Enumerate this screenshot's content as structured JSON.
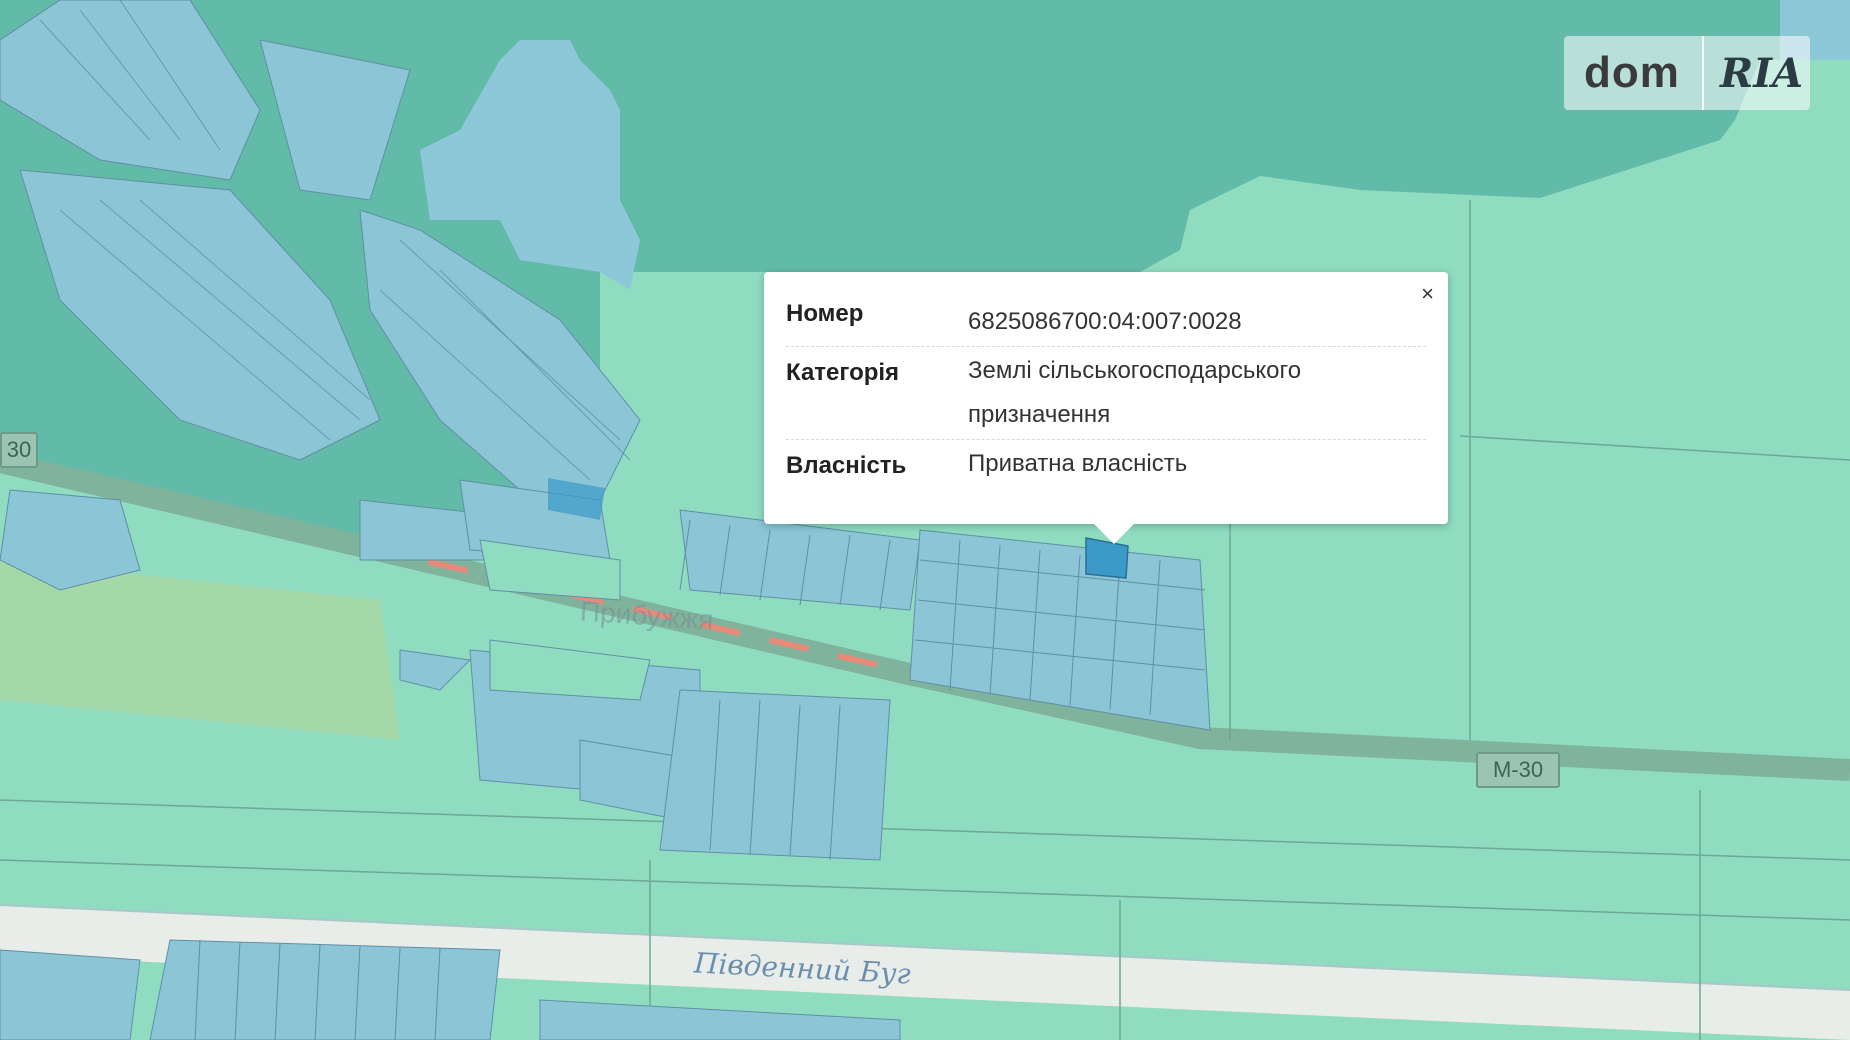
{
  "popup": {
    "close": "×",
    "rows": [
      {
        "key": "Номер",
        "value": "6825086700:04:007:0028"
      },
      {
        "key": "Категорія",
        "value": "Землі сільськогосподарського призначення"
      },
      {
        "key": "Власність",
        "value": "Приватна власність"
      }
    ]
  },
  "map": {
    "road_label": "М-30",
    "road_label_left": "30",
    "river_label": "Південний Буг",
    "village_label": "Прибужжя"
  },
  "logo": {
    "left": "dom",
    "right": "RIA"
  },
  "colors": {
    "forest": "#5db9a4",
    "field": "#8fdcc0",
    "parcel": "#8cc6d6",
    "selected_parcel": "#3c9ac8",
    "road": "#7fb39b",
    "road_highlight": "#e88a7a",
    "river": "#e8ede9",
    "water": "#8cc8d8"
  }
}
